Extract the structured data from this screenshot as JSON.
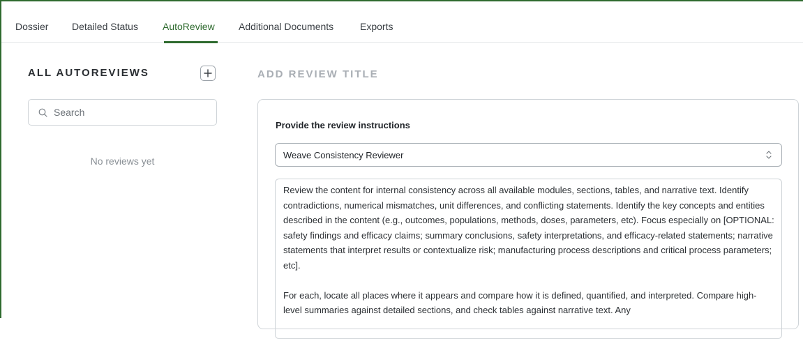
{
  "tabs": [
    {
      "label": "Dossier",
      "active": false
    },
    {
      "label": "Detailed Status",
      "active": false
    },
    {
      "label": "AutoReview",
      "active": true
    },
    {
      "label": "Additional Documents",
      "active": false
    },
    {
      "label": "Exports",
      "active": false
    }
  ],
  "sidebar": {
    "title": "ALL AUTOREVIEWS",
    "add_icon": "plus-icon",
    "search_placeholder": "Search",
    "search_icon": "search-icon",
    "empty_message": "No reviews yet"
  },
  "main": {
    "title_placeholder": "ADD REVIEW TITLE",
    "instructions_label": "Provide the review instructions",
    "selected_reviewer": "Weave Consistency Reviewer",
    "select_icon": "chevron-up-down-icon",
    "instructions_paragraphs": [
      "Review the content for internal consistency across all available modules, sections, tables, and narrative text. Identify contradictions, numerical mismatches, unit differences, and conflicting statements. Identify the key concepts and entities described in the content (e.g., outcomes, populations, methods, doses, parameters, etc). Focus especially on [OPTIONAL: safety findings and efficacy claims; summary conclusions, safety interpretations, and efficacy-related statements; narrative statements that interpret results or contextualize risk; manufacturing process descriptions and critical process parameters; etc].",
      "For each, locate all places where it appears and compare how it is defined, quantified, and interpreted. Compare high-level summaries against detailed sections, and check tables against narrative text. Any"
    ]
  },
  "colors": {
    "accent": "#2f6b2f",
    "muted_text": "#a9aeb4",
    "border": "#cfd4d8"
  }
}
